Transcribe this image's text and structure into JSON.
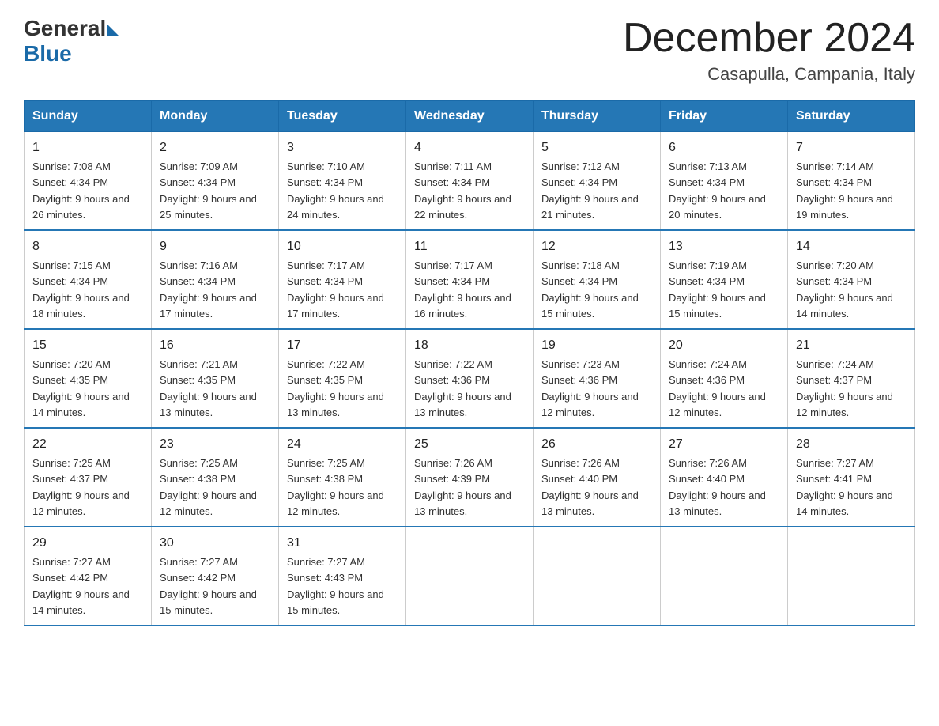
{
  "header": {
    "logo_general": "General",
    "logo_blue": "Blue",
    "month_title": "December 2024",
    "location": "Casapulla, Campania, Italy"
  },
  "days_of_week": [
    "Sunday",
    "Monday",
    "Tuesday",
    "Wednesday",
    "Thursday",
    "Friday",
    "Saturday"
  ],
  "weeks": [
    [
      {
        "day": "1",
        "sunrise": "7:08 AM",
        "sunset": "4:34 PM",
        "daylight": "9 hours and 26 minutes."
      },
      {
        "day": "2",
        "sunrise": "7:09 AM",
        "sunset": "4:34 PM",
        "daylight": "9 hours and 25 minutes."
      },
      {
        "day": "3",
        "sunrise": "7:10 AM",
        "sunset": "4:34 PM",
        "daylight": "9 hours and 24 minutes."
      },
      {
        "day": "4",
        "sunrise": "7:11 AM",
        "sunset": "4:34 PM",
        "daylight": "9 hours and 22 minutes."
      },
      {
        "day": "5",
        "sunrise": "7:12 AM",
        "sunset": "4:34 PM",
        "daylight": "9 hours and 21 minutes."
      },
      {
        "day": "6",
        "sunrise": "7:13 AM",
        "sunset": "4:34 PM",
        "daylight": "9 hours and 20 minutes."
      },
      {
        "day": "7",
        "sunrise": "7:14 AM",
        "sunset": "4:34 PM",
        "daylight": "9 hours and 19 minutes."
      }
    ],
    [
      {
        "day": "8",
        "sunrise": "7:15 AM",
        "sunset": "4:34 PM",
        "daylight": "9 hours and 18 minutes."
      },
      {
        "day": "9",
        "sunrise": "7:16 AM",
        "sunset": "4:34 PM",
        "daylight": "9 hours and 17 minutes."
      },
      {
        "day": "10",
        "sunrise": "7:17 AM",
        "sunset": "4:34 PM",
        "daylight": "9 hours and 17 minutes."
      },
      {
        "day": "11",
        "sunrise": "7:17 AM",
        "sunset": "4:34 PM",
        "daylight": "9 hours and 16 minutes."
      },
      {
        "day": "12",
        "sunrise": "7:18 AM",
        "sunset": "4:34 PM",
        "daylight": "9 hours and 15 minutes."
      },
      {
        "day": "13",
        "sunrise": "7:19 AM",
        "sunset": "4:34 PM",
        "daylight": "9 hours and 15 minutes."
      },
      {
        "day": "14",
        "sunrise": "7:20 AM",
        "sunset": "4:34 PM",
        "daylight": "9 hours and 14 minutes."
      }
    ],
    [
      {
        "day": "15",
        "sunrise": "7:20 AM",
        "sunset": "4:35 PM",
        "daylight": "9 hours and 14 minutes."
      },
      {
        "day": "16",
        "sunrise": "7:21 AM",
        "sunset": "4:35 PM",
        "daylight": "9 hours and 13 minutes."
      },
      {
        "day": "17",
        "sunrise": "7:22 AM",
        "sunset": "4:35 PM",
        "daylight": "9 hours and 13 minutes."
      },
      {
        "day": "18",
        "sunrise": "7:22 AM",
        "sunset": "4:36 PM",
        "daylight": "9 hours and 13 minutes."
      },
      {
        "day": "19",
        "sunrise": "7:23 AM",
        "sunset": "4:36 PM",
        "daylight": "9 hours and 12 minutes."
      },
      {
        "day": "20",
        "sunrise": "7:24 AM",
        "sunset": "4:36 PM",
        "daylight": "9 hours and 12 minutes."
      },
      {
        "day": "21",
        "sunrise": "7:24 AM",
        "sunset": "4:37 PM",
        "daylight": "9 hours and 12 minutes."
      }
    ],
    [
      {
        "day": "22",
        "sunrise": "7:25 AM",
        "sunset": "4:37 PM",
        "daylight": "9 hours and 12 minutes."
      },
      {
        "day": "23",
        "sunrise": "7:25 AM",
        "sunset": "4:38 PM",
        "daylight": "9 hours and 12 minutes."
      },
      {
        "day": "24",
        "sunrise": "7:25 AM",
        "sunset": "4:38 PM",
        "daylight": "9 hours and 12 minutes."
      },
      {
        "day": "25",
        "sunrise": "7:26 AM",
        "sunset": "4:39 PM",
        "daylight": "9 hours and 13 minutes."
      },
      {
        "day": "26",
        "sunrise": "7:26 AM",
        "sunset": "4:40 PM",
        "daylight": "9 hours and 13 minutes."
      },
      {
        "day": "27",
        "sunrise": "7:26 AM",
        "sunset": "4:40 PM",
        "daylight": "9 hours and 13 minutes."
      },
      {
        "day": "28",
        "sunrise": "7:27 AM",
        "sunset": "4:41 PM",
        "daylight": "9 hours and 14 minutes."
      }
    ],
    [
      {
        "day": "29",
        "sunrise": "7:27 AM",
        "sunset": "4:42 PM",
        "daylight": "9 hours and 14 minutes."
      },
      {
        "day": "30",
        "sunrise": "7:27 AM",
        "sunset": "4:42 PM",
        "daylight": "9 hours and 15 minutes."
      },
      {
        "day": "31",
        "sunrise": "7:27 AM",
        "sunset": "4:43 PM",
        "daylight": "9 hours and 15 minutes."
      },
      null,
      null,
      null,
      null
    ]
  ]
}
